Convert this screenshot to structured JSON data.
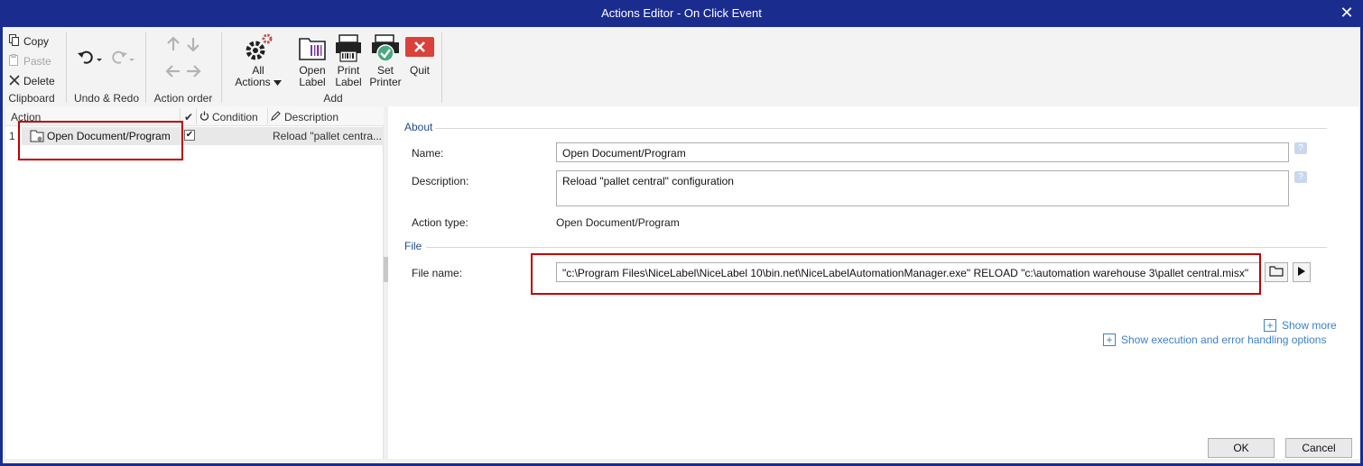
{
  "window": {
    "title": "Actions Editor - On Click Event",
    "close_glyph": "✕"
  },
  "ribbon": {
    "clipboard": {
      "label": "Clipboard",
      "copy": "Copy",
      "paste": "Paste",
      "delete": "Delete"
    },
    "undo_redo": {
      "label": "Undo & Redo"
    },
    "action_order": {
      "label": "Action order"
    },
    "add": {
      "label": "Add",
      "all_actions": [
        "All",
        "Actions"
      ],
      "open_label": [
        "Open",
        "Label"
      ],
      "print_label": [
        "Print",
        "Label"
      ],
      "set_printer": [
        "Set",
        "Printer"
      ],
      "quit": "Quit"
    }
  },
  "actions_grid": {
    "headers": {
      "action": "Action",
      "check": "✔",
      "condition": "Condition",
      "description": "Description"
    },
    "rows": [
      {
        "index": "1",
        "name": "Open Document/Program",
        "checked": "✔",
        "description": "Reload \"pallet centra..."
      }
    ]
  },
  "details": {
    "about_section": "About",
    "name_label": "Name:",
    "name_value": "Open Document/Program",
    "description_label": "Description:",
    "description_value": "Reload \"pallet central\" configuration",
    "action_type_label": "Action type:",
    "action_type_value": "Open Document/Program",
    "file_section": "File",
    "file_name_label": "File name:",
    "file_name_value": "\"c:\\Program Files\\NiceLabel\\NiceLabel 10\\bin.net\\NiceLabelAutomationManager.exe\" RELOAD \"c:\\automation warehouse 3\\pallet central.misx\"",
    "show_more": "Show more",
    "show_execution": "Show execution and error handling options",
    "help_glyph": "?"
  },
  "dialog": {
    "ok": "OK",
    "cancel": "Cancel"
  },
  "icons": [
    "copy-icon",
    "paste-icon",
    "delete-icon",
    "undo-icon",
    "redo-icon",
    "move-up-icon",
    "move-down-icon",
    "move-left-icon",
    "move-right-icon",
    "all-actions-gear-icon",
    "open-label-icon",
    "print-label-icon",
    "set-printer-icon",
    "quit-icon",
    "document-program-icon",
    "folder-icon",
    "play-icon"
  ],
  "colors": {
    "titlebar": "#1b2c8f",
    "highlight_box": "#c00000",
    "link": "#3d80c8",
    "quit_red": "#d9413a",
    "section_blue": "#1e4b8f"
  }
}
